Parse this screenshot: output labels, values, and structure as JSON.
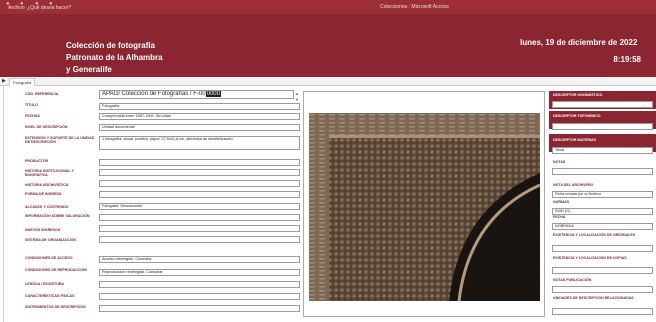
{
  "window": {
    "app_name": "Archivo",
    "help_label": "¿Qué desea hacer?",
    "title": "Colecciones : Microsoft Access"
  },
  "header": {
    "line1": "Colección de fotografía",
    "line2": "Patronato de la Alhambra",
    "line3": "y Generalife",
    "date": "lunes, 19 de diciembre de 2022",
    "time": "8:19:58"
  },
  "tab": {
    "label": "Fotografía"
  },
  "record": {
    "cod_referencia_pre": "APAG/ Colección de Fotografías / F-00",
    "cod_referencia_sel": "0000",
    "titulo": "Fotografía",
    "fechas": "Comprendida entre 1857-1900. Sin datar",
    "nivel": "Unidad documental",
    "extension": "1 fotografía, visual, positivo, papel, 27,6x21,8 cm, albúmina de sensibilización",
    "autor": "Fotógrafo: Desconocido",
    "condiciones_acceso": "Acceso restringido. Consultar",
    "condiciones_reproduccion": "Reproducción restringida. Consultar",
    "rlabel_4": "Tema",
    "nota_archivero": "Ficha creada por el Archivo",
    "regla_1": "ISAD (G)",
    "regla_2": "NOBRADA"
  },
  "left_labels": [
    "Cód. referencia",
    "Título",
    "Fechas",
    "Nivel de descripción",
    "Extensión y soporte de la unidad de descripción",
    "Productor",
    "Historia institucional y biográfica",
    "Historia archivística",
    "Forma de ingreso",
    "Alcance y contenido",
    "Información sobre valoración",
    "Nuevos ingresos",
    "Sistema de organización",
    "Condiciones de acceso",
    "Condiciones de reproducción",
    "Lengua / escritura",
    "Características físicas",
    "Instrumentos de descripción"
  ],
  "right_labels": [
    "Descriptor onomástico",
    "Descriptor toponímico",
    "Descriptor materias",
    "Notas",
    "Nota del archivero",
    "Normas",
    "Fecha",
    "Existencia y localización de originales",
    "Existencia y localización de copias",
    "Notas publicación",
    "Unidades de descripción relacionadas"
  ],
  "colors": {
    "brand": "#8a2531",
    "titlebar": "#9c2e35",
    "label": "#7a2430"
  }
}
